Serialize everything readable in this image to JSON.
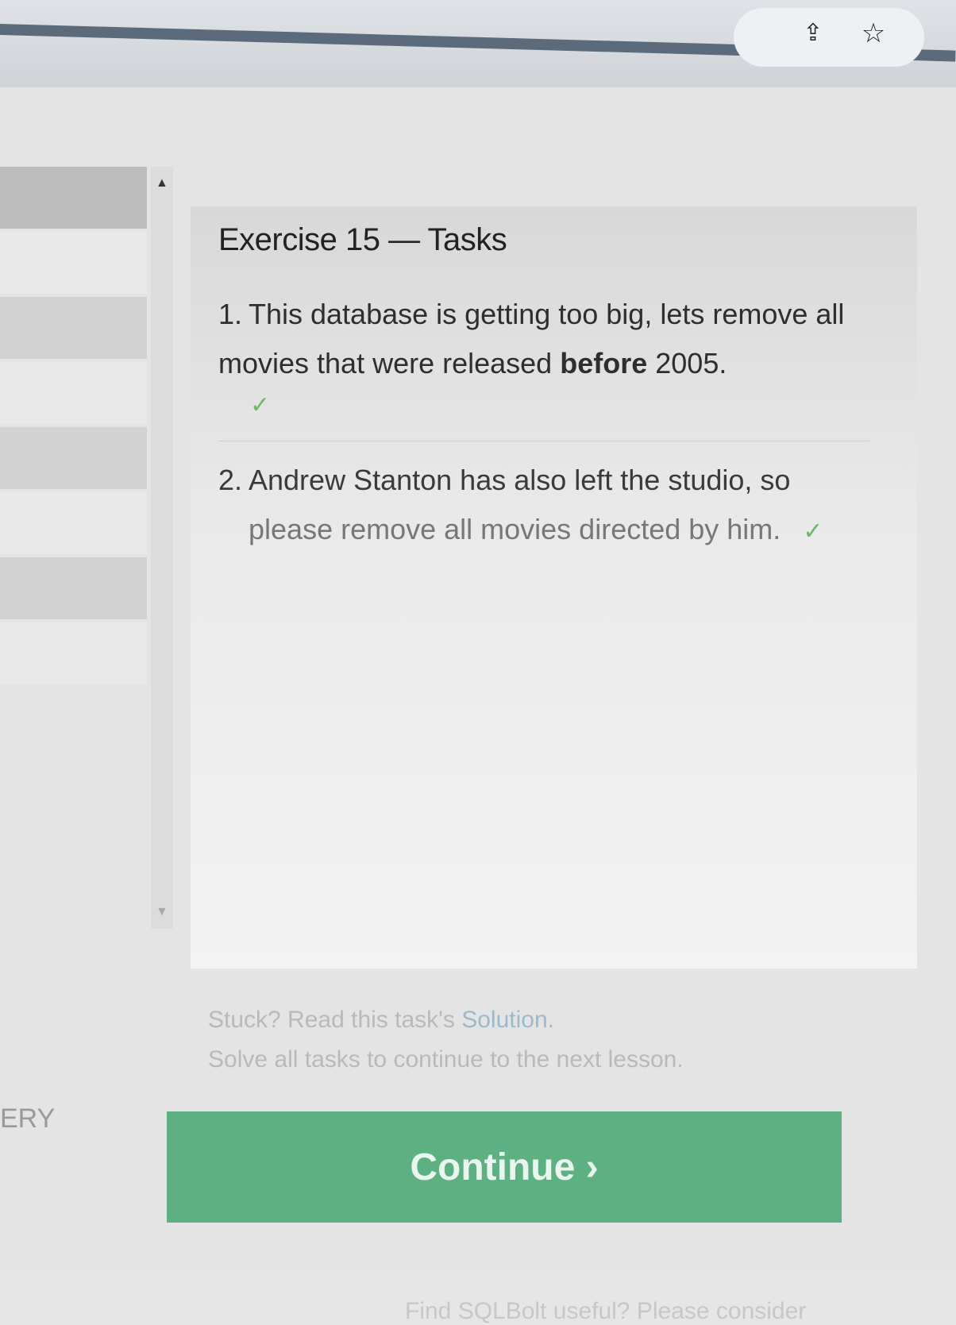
{
  "browser": {
    "share_icon": "share-icon",
    "star_icon": "star-icon"
  },
  "exercise": {
    "title": "Exercise 15 — Tasks",
    "tasks": [
      {
        "number": "1.",
        "text_before": "This database is getting too big, lets remove all movies that were released ",
        "text_bold": "before",
        "text_after": " 2005.",
        "completed_mark": "✓"
      },
      {
        "number": "2.",
        "text_line1": "Andrew Stanton has also left the studio, so",
        "text_line2": "please remove all movies directed by him.",
        "completed_mark": "✓"
      }
    ]
  },
  "hints": {
    "stuck_prefix": "Stuck? Read this task's ",
    "solution_link": "Solution.",
    "solve_all": "Solve all tasks to continue to the next lesson."
  },
  "continue_button": {
    "label": "Continue ›"
  },
  "footer": {
    "text": "Find SQLBolt useful? Please consider"
  },
  "left_panel": {
    "tail_text": "ERY"
  },
  "colors": {
    "continue_green": "#5cb082",
    "check_green": "#6db86d"
  }
}
